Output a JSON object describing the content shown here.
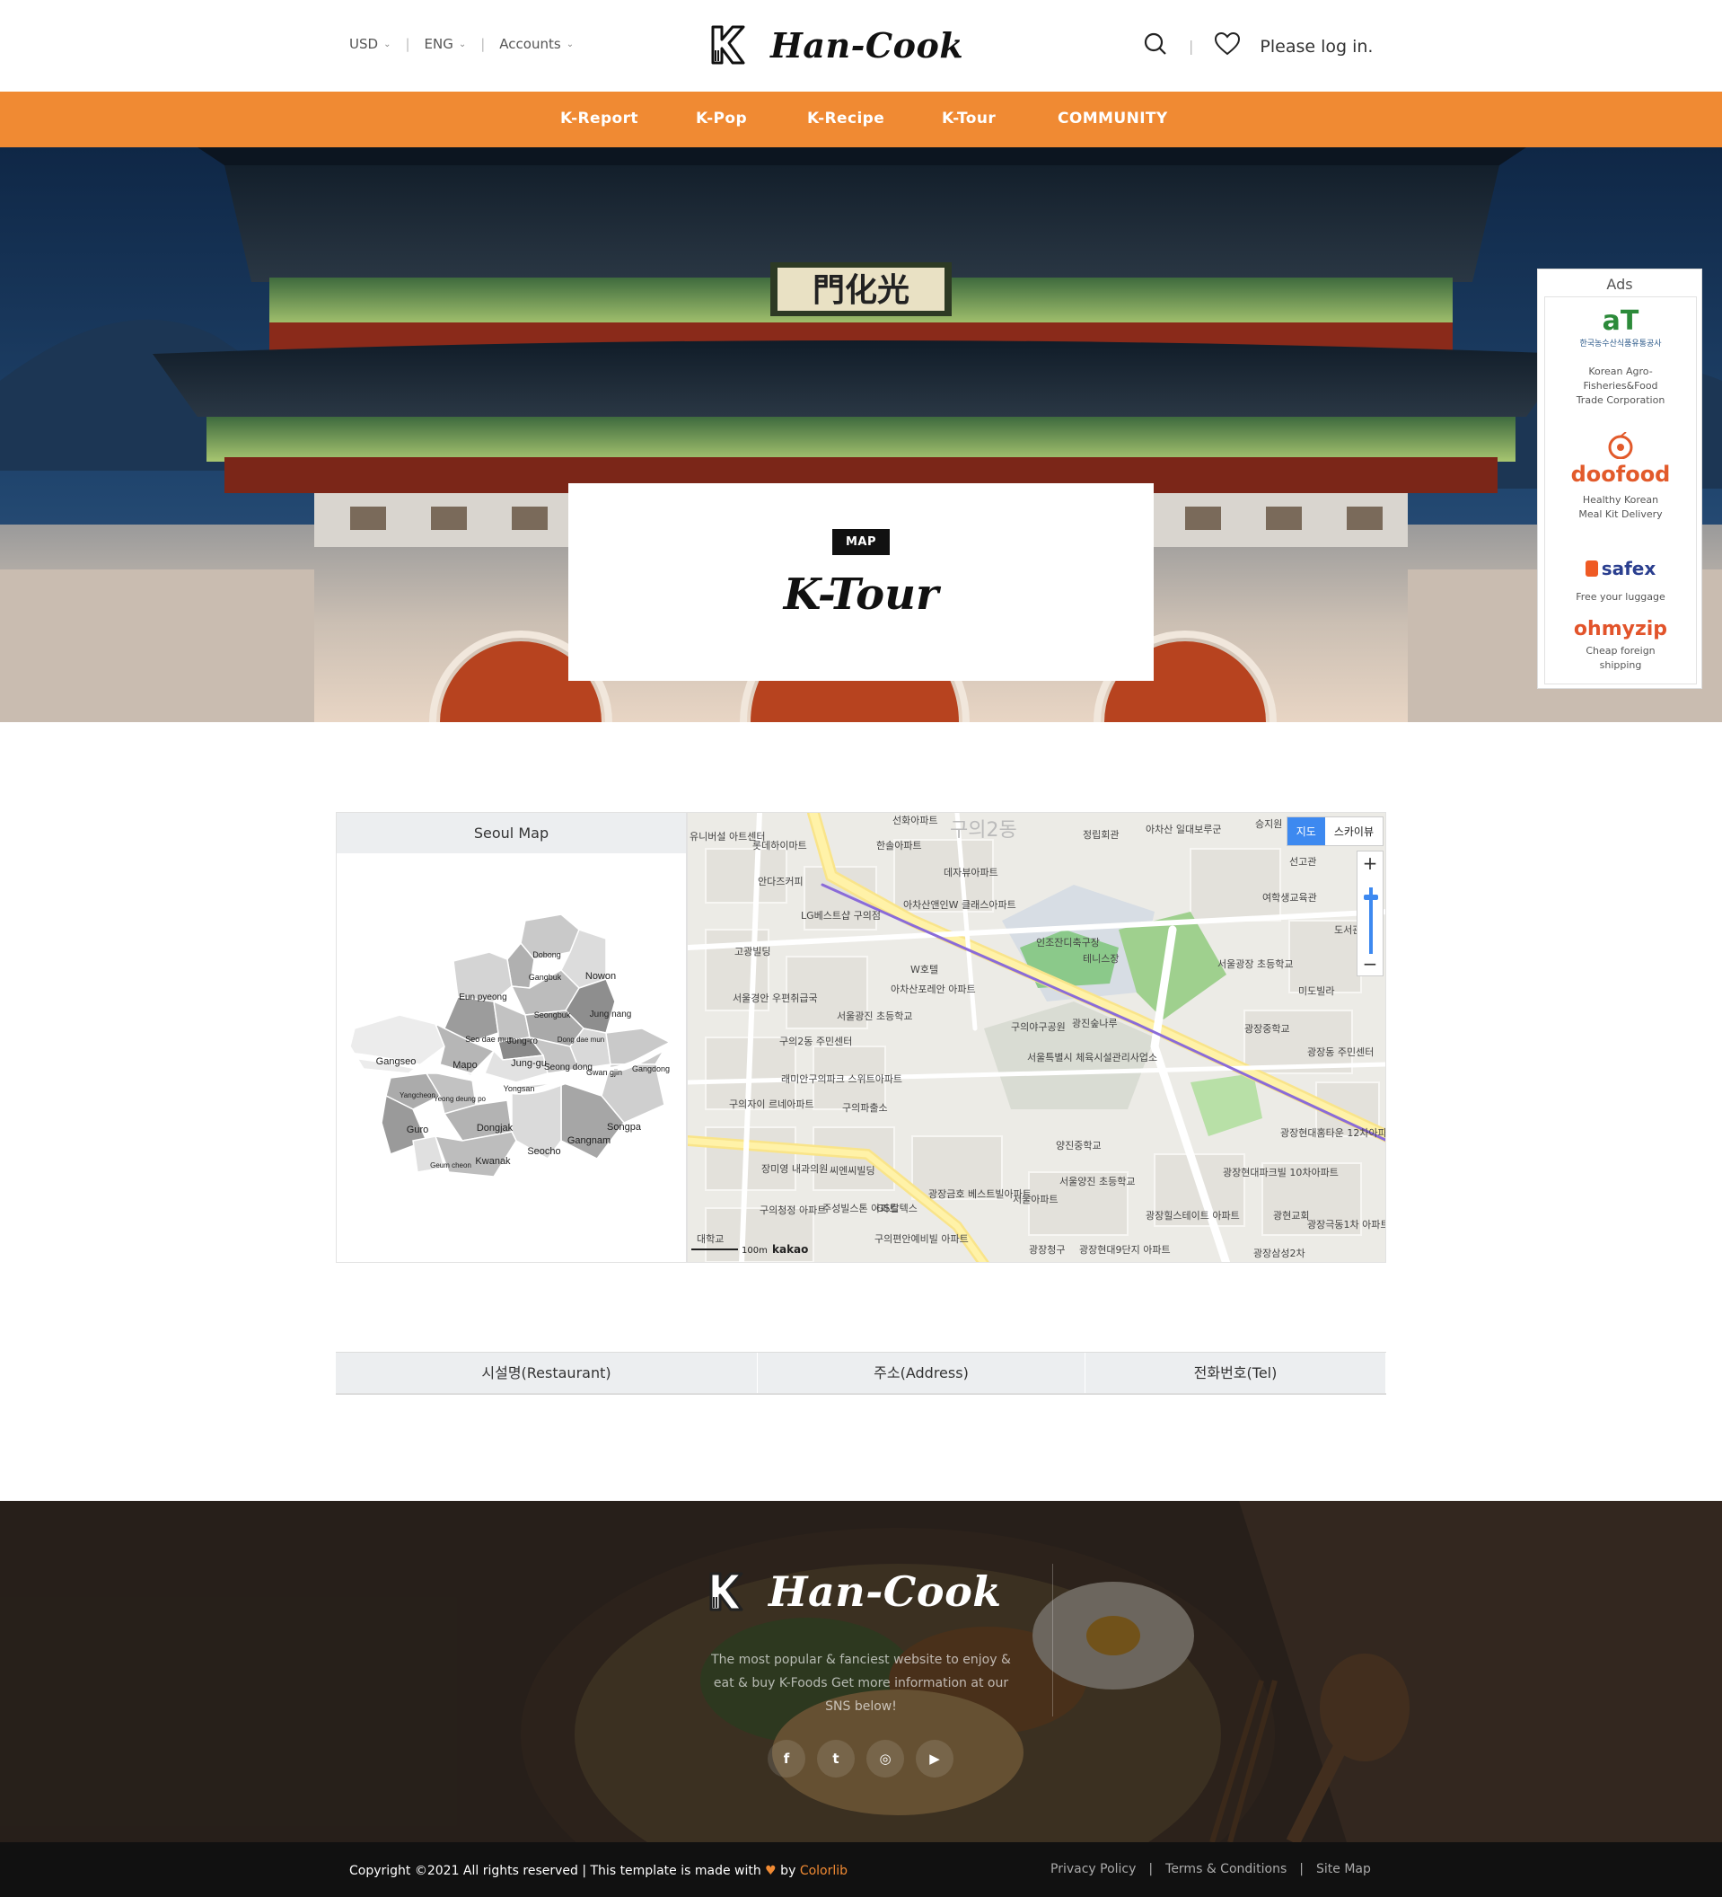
{
  "top": {
    "currency": "USD",
    "language": "ENG",
    "accounts": "Accounts",
    "logo_text": "Han-Cook",
    "login_text": "Please log in."
  },
  "nav": {
    "items": [
      {
        "label": "K-Report"
      },
      {
        "label": "K-Pop"
      },
      {
        "label": "K-Recipe"
      },
      {
        "label": "K-Tour"
      },
      {
        "label": "COMMUNITY"
      }
    ]
  },
  "hero": {
    "badge": "MAP",
    "title": "K-Tour",
    "sign_text": "門化光"
  },
  "ads": {
    "title": "Ads",
    "items": [
      {
        "name": "aT",
        "sub": "한국농수산식품유통공사",
        "desc1": "Korean Agro-",
        "desc2": "Fisheries&Food",
        "desc3": "Trade Corporation"
      },
      {
        "name": "doofood",
        "desc1": "Healthy Korean",
        "desc2": "Meal Kit Delivery"
      },
      {
        "name": "safex",
        "desc1": "Free your luggage"
      },
      {
        "name": "ohmyzip",
        "desc1": "Cheap foreign",
        "desc2": "shipping"
      }
    ]
  },
  "seoul_map": {
    "title": "Seoul Map",
    "districts": [
      "Dobong",
      "Gangbuk",
      "Nowon",
      "Eun pyeong",
      "Seongbuk",
      "Jung nang",
      "Seo dae mun",
      "Jong-ro",
      "Dong dae mun",
      "Gangseo",
      "Mapo",
      "Jung-gu",
      "Seong dong",
      "Gwan gjin",
      "Gangdong",
      "Yongsan",
      "Yangcheon",
      "Yeong deung po",
      "Guro",
      "Dongjak",
      "Songpa",
      "Gangnam",
      "Seocho",
      "Geum cheon",
      "Kwanak"
    ]
  },
  "kakao_map": {
    "map_type_on": "지도",
    "map_type_off": "스카이뷰",
    "zoom_in": "+",
    "zoom_out": "−",
    "scale": "100m",
    "brand": "kakao",
    "labels": [
      "선화아파트",
      "구의2동",
      "정립회관",
      "아차산 일대보루군",
      "승지원",
      "유니버설 아트센터",
      "롯데하이마트",
      "한솔아파트",
      "데자뷰아파트",
      "선고관",
      "안다즈커피",
      "아차산앤인W 클래스아파트",
      "여학생교육관",
      "LG베스트샵 구의점",
      "인조잔디축구장",
      "테니스장",
      "고광빌딩",
      "W호텔",
      "서울광장 초등학교",
      "서울경안 우편취급국",
      "아차산포레안 아파트",
      "서울광진 초등학교",
      "구의야구공원",
      "광진숲나루",
      "미도빌라",
      "구의2동 주민센터",
      "서울특별시 체육시설관리사업소",
      "광장중학교",
      "광장동 주민센터",
      "래미안구의파크 스위트아파트",
      "구의파출소",
      "구의자이 르네아파트",
      "광장현대홈타운 12차아파트",
      "장미영 내과의원",
      "씨엔씨빌딩",
      "양진중학교",
      "서울양진 초등학교",
      "광장현대파크빌 10차아파트",
      "광장금호 베스트빌아파트",
      "서울아파트",
      "구의청정 아파트",
      "주성빌스톤 아파트",
      "GS칼텍스",
      "광장힐스테이트 아파트",
      "광현교회",
      "구의편안예비빌 아파트",
      "광장극동1차 아파트",
      "광장청구",
      "광장현대9단지 아파트",
      "광장삼성2차",
      "도서관",
      "대학교"
    ]
  },
  "table": {
    "headers": [
      "시설명(Restaurant)",
      "주소(Address)",
      "전화번호(Tel)"
    ]
  },
  "footer": {
    "logo_text": "Han-Cook",
    "desc": "The most popular & fanciest website to enjoy & eat & buy K-Foods Get more information at our SNS below!",
    "social": [
      {
        "icon": "facebook-icon",
        "glyph": "f"
      },
      {
        "icon": "twitter-icon",
        "glyph": "t"
      },
      {
        "icon": "instagram-icon",
        "glyph": "◎"
      },
      {
        "icon": "youtube-icon",
        "glyph": "▶"
      }
    ],
    "copyright_pre": "Copyright ©2021 All rights reserved | This template is made with ",
    "copyright_by": " by ",
    "copyright_brand": "Colorlib",
    "links": [
      "Privacy Policy",
      "Terms & Conditions",
      "Site Map"
    ]
  },
  "colors": {
    "accent": "#f08a33",
    "dark": "#111111",
    "panel": "#eceef0"
  }
}
